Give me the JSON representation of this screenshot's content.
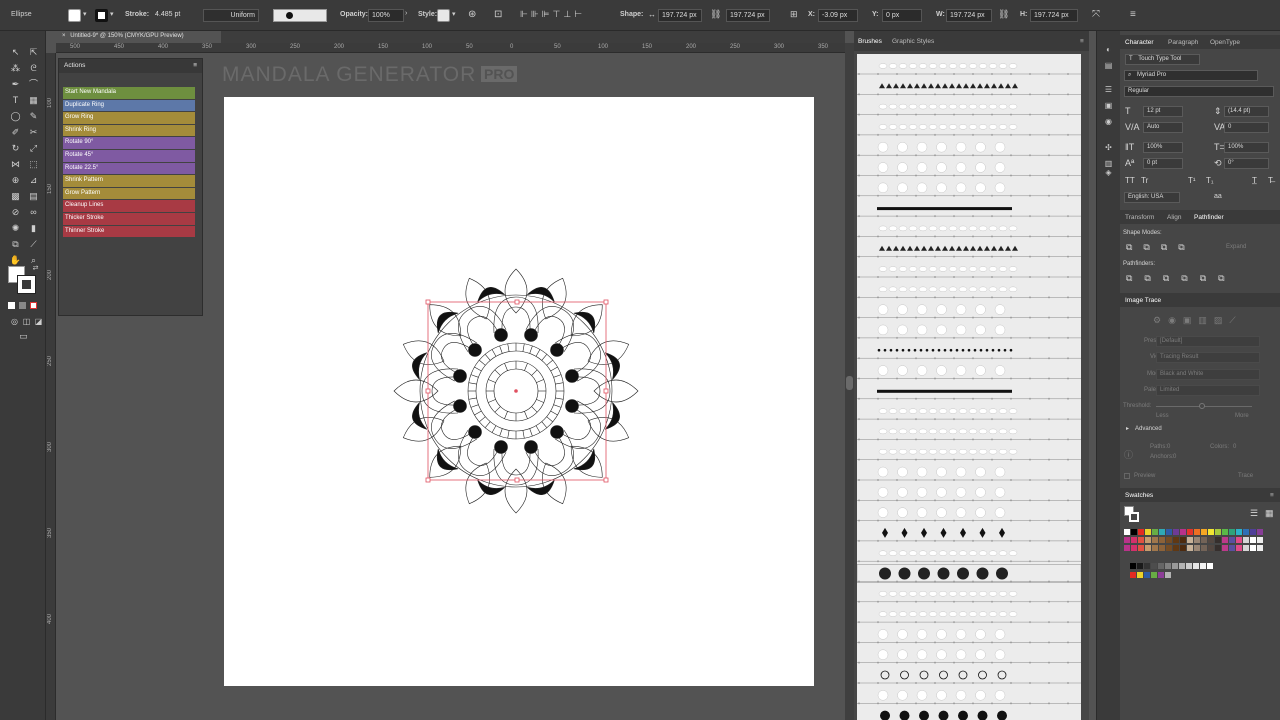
{
  "control_bar": {
    "tool_name": "Ellipse",
    "stroke_label": "Stroke:",
    "stroke_value": "4.485 pt",
    "profile_value": "Uniform",
    "opacity_label": "Opacity:",
    "opacity_value": "100%",
    "style_label": "Style:",
    "shape_label": "Shape:",
    "shape_w": "197.724 px",
    "shape_h": "197.724 px",
    "x_label": "X:",
    "x_value": "-3.09 px",
    "y_label": "Y:",
    "y_value": "0 px",
    "w_label": "W:",
    "w_value": "197.724 px",
    "h_label": "H:",
    "h_value": "197.724 px"
  },
  "document_tab": {
    "title": "Untitled-9* @ 150% (CMYK/GPU Preview)",
    "close_glyph": "×"
  },
  "ruler_h": [
    "500",
    "450",
    "400",
    "350",
    "300",
    "250",
    "200",
    "150",
    "100",
    "50",
    "0",
    "50",
    "100",
    "150",
    "200",
    "250",
    "300",
    "350",
    "400"
  ],
  "ruler_v": [
    "100",
    "150",
    "200",
    "250",
    "300",
    "350",
    "400"
  ],
  "canvas": {
    "title": "MANDALA GENERATOR",
    "pro": "PRO"
  },
  "actions_panel": {
    "title": "Actions",
    "items": [
      {
        "label": "Start New Mandala",
        "color": "#6e8f3f"
      },
      {
        "label": "Duplicate Ring",
        "color": "#5d78a8"
      },
      {
        "label": "Grow Ring",
        "color": "#a48c3a"
      },
      {
        "label": "Shrink Ring",
        "color": "#a48c3a"
      },
      {
        "label": "Rotate 90°",
        "color": "#7f5aa2"
      },
      {
        "label": "Rotate 45°",
        "color": "#7f5aa2"
      },
      {
        "label": "Rotate 22.5°",
        "color": "#7f5aa2"
      },
      {
        "label": "Shrink Pattern",
        "color": "#a48c3a"
      },
      {
        "label": "Grow Pattern",
        "color": "#a48c3a"
      },
      {
        "label": "Cleanup Lines",
        "color": "#a83a44"
      },
      {
        "label": "Thicker Stroke",
        "color": "#a83a44"
      },
      {
        "label": "Thinner Stroke",
        "color": "#a83a44"
      }
    ]
  },
  "brushes_panel": {
    "tab_brushes": "Brushes",
    "tab_graphic_styles": "Graphic Styles"
  },
  "character_panel": {
    "tab_character": "Character",
    "tab_paragraph": "Paragraph",
    "tab_opentype": "OpenType",
    "touch_type": "Touch Type Tool",
    "font_family": "Myriad Pro",
    "font_style": "Regular",
    "font_size": "12 pt",
    "leading": "(14.4 pt)",
    "kerning": "Auto",
    "tracking": "0",
    "vscale": "100%",
    "hscale": "100%",
    "baseline": "0 pt",
    "rotation": "0°",
    "language": "English: USA",
    "tt1": "TT",
    "tt2": "Tr",
    "tt3": "T¹",
    "tt4": "T₁"
  },
  "pathfinder_panel": {
    "tab_transform": "Transform",
    "tab_align": "Align",
    "tab_pathfinder": "Pathfinder",
    "shape_modes": "Shape Modes:",
    "pathfinders": "Pathfinders:",
    "expand": "Expand"
  },
  "image_trace_panel": {
    "title": "Image Trace",
    "preset_label": "Preset:",
    "preset_value": "[Default]",
    "view_label": "View:",
    "view_value": "Tracing Result",
    "mode_label": "Mode:",
    "mode_value": "Black and White",
    "palette_label": "Palette:",
    "palette_value": "Limited",
    "threshold_label": "Threshold:",
    "less": "Less",
    "more": "More",
    "advanced": "Advanced",
    "paths_label": "Paths:",
    "paths_value": "0",
    "colors_label": "Colors:",
    "colors_value": "0",
    "anchors_label": "Anchors:",
    "anchors_value": "0",
    "preview": "Preview",
    "trace": "Trace"
  },
  "swatches_panel": {
    "title": "Swatches",
    "row1": [
      "#ffffff",
      "#000000",
      "#e32b22",
      "#ebd22b",
      "#68ad45",
      "#30a9b5",
      "#2e5ca7",
      "#6e3b96",
      "#b8318a",
      "#e4332b",
      "#ee6f23",
      "#f5a623",
      "#f2e532",
      "#a5c93d",
      "#5bb947",
      "#2ea37a",
      "#2cb2c9",
      "#2f70b6",
      "#4f3f98",
      "#883d97"
    ],
    "row2": [
      "#b9338a",
      "#d4306b",
      "#e15141",
      "#c69c6d",
      "#a0774c",
      "#8c6239",
      "#754c24",
      "#603813",
      "#4d2a0e",
      "#c7b299",
      "#998675",
      "#736357",
      "#534741",
      "#362f2d",
      "#bc3a8a",
      "#5a4fa0",
      "#e04b89",
      "#d6d6d6",
      "#ffffff",
      "#eeeeee"
    ],
    "greys": [
      "#000000",
      "#1a1a1a",
      "#333333",
      "#4d4d4d",
      "#666666",
      "#808080",
      "#999999",
      "#b3b3b3",
      "#cccccc",
      "#e6e6e6",
      "#f2f2f2",
      "#ffffff"
    ],
    "row4": [
      "#e32b22",
      "#ebd22b",
      "#2e5ca7",
      "#68ad45",
      "#8c3d97",
      "#b3b3b3"
    ]
  }
}
